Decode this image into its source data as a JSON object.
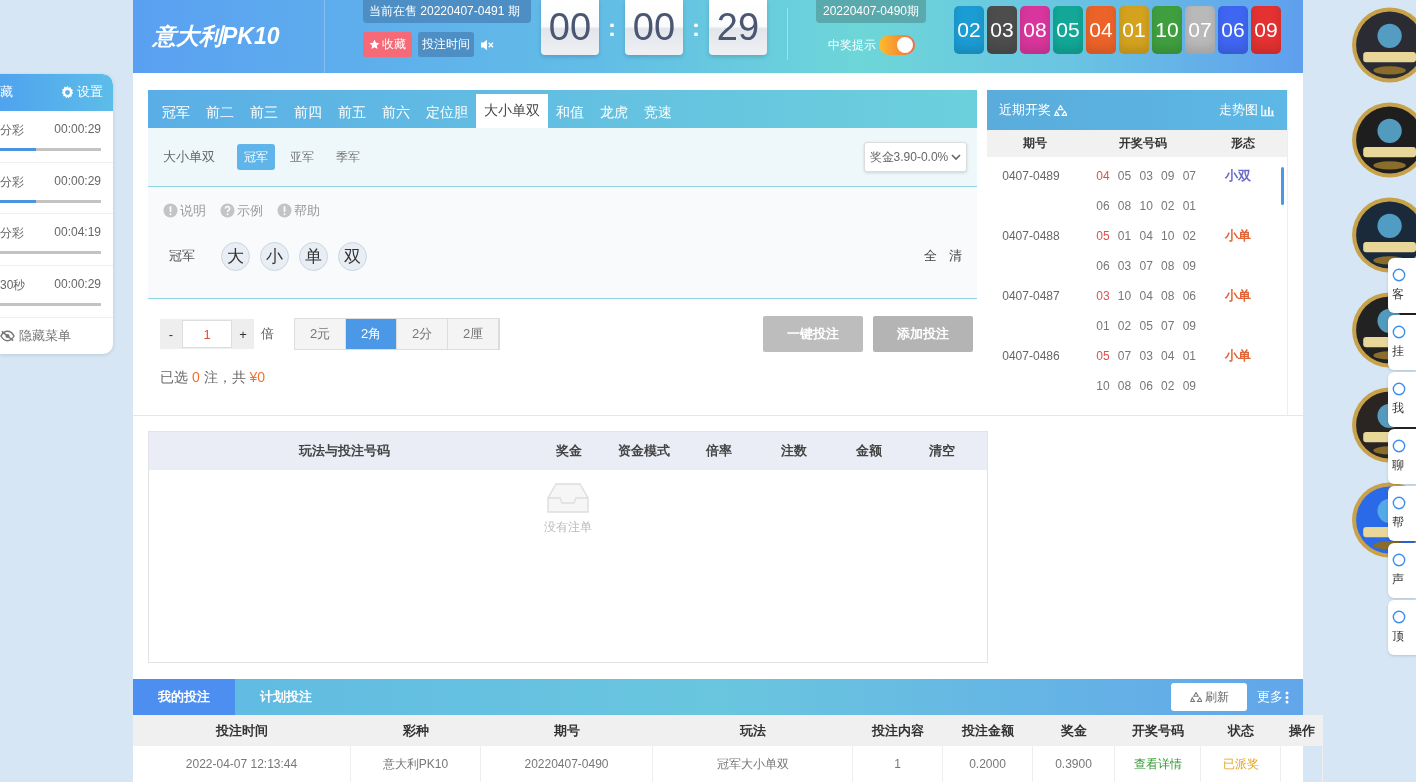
{
  "sidebar": {
    "title": "藏",
    "settings": "设置",
    "items": [
      {
        "name": "分彩",
        "time": "00:00:29",
        "level": 0.36
      },
      {
        "name": "分彩",
        "time": "00:00:29",
        "level": 0.36
      },
      {
        "name": "分彩",
        "time": "00:04:19",
        "level": 0
      },
      {
        "name": "30秒",
        "time": "00:00:29",
        "level": 0
      }
    ],
    "hide_menu": "隐藏菜单"
  },
  "header": {
    "logo": "意大利PK10",
    "current_period": "当前在售 20220407-0491 期",
    "favorite": "收藏",
    "bet_time": "投注时间",
    "muted": true,
    "countdown": [
      "00",
      "00",
      "29"
    ],
    "separator": ":",
    "last_period": "20220407-0490期",
    "win_alert": {
      "label": "中奖提示",
      "on": true
    },
    "balls": [
      {
        "number": "02",
        "color": "#1b9cd3"
      },
      {
        "number": "03",
        "color": "#4d4d4d"
      },
      {
        "number": "08",
        "color": "#d8369c"
      },
      {
        "number": "05",
        "color": "#12a796"
      },
      {
        "number": "04",
        "color": "#ec6329"
      },
      {
        "number": "01",
        "color": "#d3a21f"
      },
      {
        "number": "10",
        "color": "#3f9f3f"
      },
      {
        "number": "07",
        "color": "#b9b9b9"
      },
      {
        "number": "06",
        "color": "#3f66f2"
      },
      {
        "number": "09",
        "color": "#e43131"
      }
    ]
  },
  "play_tabs": [
    {
      "label": "冠军",
      "selected": false
    },
    {
      "label": "前二",
      "selected": false
    },
    {
      "label": "前三",
      "selected": false
    },
    {
      "label": "前四",
      "selected": false
    },
    {
      "label": "前五",
      "selected": false
    },
    {
      "label": "前六",
      "selected": false
    },
    {
      "label": "定位胆",
      "selected": false
    },
    {
      "label": "大小单双",
      "selected": true
    },
    {
      "label": "和值",
      "selected": false
    },
    {
      "label": "龙虎",
      "selected": false
    },
    {
      "label": "竞速",
      "selected": false
    }
  ],
  "sub_play": {
    "label": "大小单双",
    "options": [
      {
        "label": "冠军",
        "selected": true
      },
      {
        "label": "亚军",
        "selected": false
      },
      {
        "label": "季军",
        "selected": false
      }
    ],
    "prize_select": "奖金3.90-0.0%"
  },
  "help_links": [
    "说明",
    "示例",
    "帮助"
  ],
  "pick_row": {
    "label": "冠军",
    "balls": [
      {
        "label": "大",
        "selected": false
      },
      {
        "label": "小",
        "selected": false
      },
      {
        "label": "单",
        "selected": false
      },
      {
        "label": "双",
        "selected": false
      }
    ],
    "actions": [
      "全",
      "清"
    ]
  },
  "bet": {
    "minus": "-",
    "multiple": "1",
    "plus": "+",
    "multiple_unit": "倍",
    "units": [
      {
        "label": "2元",
        "selected": false
      },
      {
        "label": "2角",
        "selected": true
      },
      {
        "label": "2分",
        "selected": false
      },
      {
        "label": "2厘",
        "selected": false
      }
    ],
    "quick_bet": "一键投注",
    "add_bet": "添加投注",
    "summary": {
      "prefix": "已选",
      "count": "0",
      "middle": "注，共",
      "total": "¥0"
    }
  },
  "order_table": {
    "columns": [
      "玩法与投注号码",
      "奖金",
      "资金模式",
      "倍率",
      "注数",
      "金额",
      "清空"
    ],
    "empty_text": "没有注单"
  },
  "recent_draws": {
    "title": "近期开奖",
    "trend": "走势图",
    "columns": [
      "期号",
      "开奖号码",
      "形态"
    ],
    "rows": [
      {
        "period": "0407-0489",
        "numbers": [
          "04",
          "05",
          "03",
          "09",
          "07",
          "06",
          "08",
          "10",
          "02",
          "01"
        ],
        "shape": "小双",
        "color": "#6a6ac6"
      },
      {
        "period": "0407-0488",
        "numbers": [
          "05",
          "01",
          "04",
          "10",
          "02",
          "06",
          "03",
          "07",
          "08",
          "09"
        ],
        "shape": "小单",
        "color": "#e0663a"
      },
      {
        "period": "0407-0487",
        "numbers": [
          "03",
          "10",
          "04",
          "08",
          "06",
          "01",
          "02",
          "05",
          "07",
          "09"
        ],
        "shape": "小单",
        "color": "#e0663a"
      },
      {
        "period": "0407-0486",
        "numbers": [
          "05",
          "07",
          "03",
          "04",
          "01",
          "10",
          "08",
          "06",
          "02",
          "09"
        ],
        "shape": "小单",
        "color": "#e0663a"
      }
    ]
  },
  "bets": {
    "tabs": [
      {
        "label": "我的投注",
        "selected": true
      },
      {
        "label": "计划投注",
        "selected": false
      }
    ],
    "refresh": "刷新",
    "more": "更多",
    "columns": [
      "投注时间",
      "彩种",
      "期号",
      "玩法",
      "投注内容",
      "投注金额",
      "奖金",
      "开奖号码",
      "状态",
      "操作"
    ],
    "rows": [
      {
        "time": "2022-04-07 12:13:44",
        "lottery": "意大利PK10",
        "period": "20220407-0490",
        "play": "冠军大小单双",
        "content": "1",
        "amount": "0.2000",
        "prize": "0.3900",
        "draw_link": "查看详情",
        "status": "已派奖"
      }
    ]
  },
  "side_tools": [
    "客",
    "挂",
    "我",
    "聊",
    "帮",
    "声",
    "顶"
  ]
}
